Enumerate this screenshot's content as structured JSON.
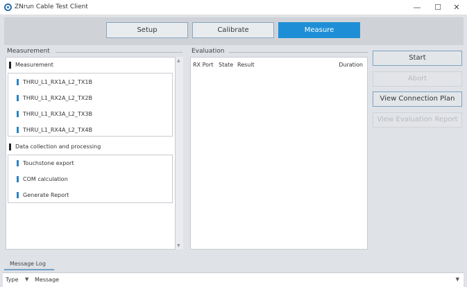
{
  "window": {
    "title": "ZNrun Cable Test Client",
    "minimize": "—",
    "maximize": "☐",
    "close": "✕"
  },
  "tabs": [
    {
      "label": "Setup",
      "active": false
    },
    {
      "label": "Calibrate",
      "active": false
    },
    {
      "label": "Measure",
      "active": true
    }
  ],
  "measurement": {
    "section_label": "Measurement",
    "groups": [
      {
        "label": "Measurement",
        "items": [
          "THRU_L1_RX1A_L2_TX1B",
          "THRU_L1_RX2A_L2_TX2B",
          "THRU_L1_RX3A_L2_TX3B",
          "THRU_L1_RX4A_L2_TX4B"
        ]
      },
      {
        "label": "Data collection and processing",
        "items": [
          "Touchstone export",
          "COM calculation",
          "Generate Report"
        ]
      }
    ]
  },
  "evaluation": {
    "section_label": "Evaluation",
    "columns": [
      "RX Port",
      "State",
      "Result",
      "Duration"
    ]
  },
  "actions": [
    {
      "label": "Start",
      "enabled": true
    },
    {
      "label": "Abort",
      "enabled": false
    },
    {
      "label": "View Connection Plan",
      "enabled": true
    },
    {
      "label": "View Evaluation Report",
      "enabled": false
    }
  ],
  "log": {
    "tab_label": "Message Log",
    "columns": [
      "Type",
      "Message"
    ],
    "filter_icon": "filter-icon",
    "pin_icon": "pin-icon"
  },
  "colors": {
    "accent": "#1e8fd6",
    "item_marker": "#2a83c4",
    "background": "#dfe2e6"
  }
}
